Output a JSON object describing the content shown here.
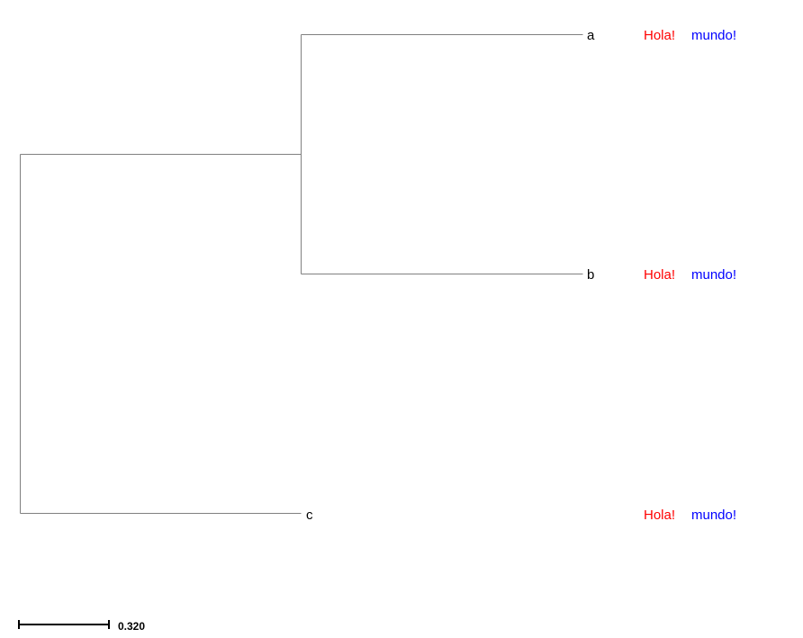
{
  "tree": {
    "leaves": [
      {
        "name": "a",
        "faces": [
          "Hola!",
          "mundo!"
        ]
      },
      {
        "name": "b",
        "faces": [
          "Hola!",
          "mundo!"
        ]
      },
      {
        "name": "c",
        "faces": [
          "Hola!",
          "mundo!"
        ]
      }
    ],
    "face_colors": [
      "#ff0000",
      "#0000ff"
    ],
    "branch_color": "#808080"
  },
  "scale": {
    "label": "0.320"
  }
}
